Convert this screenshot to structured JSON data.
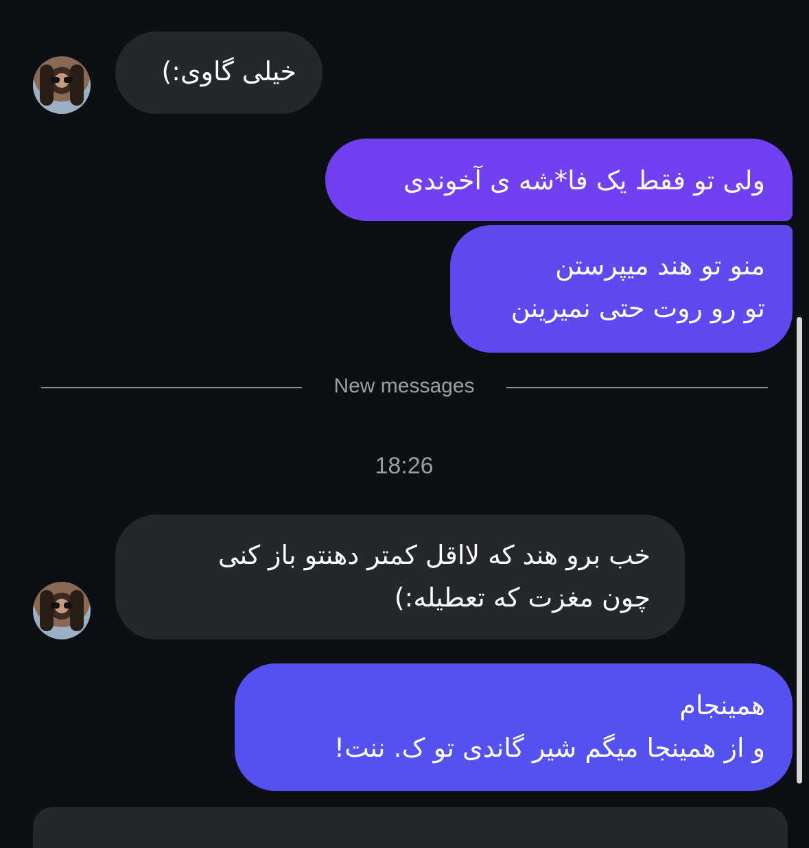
{
  "messages": [
    {
      "sender": "other",
      "text": "خیلی گاوی:)"
    },
    {
      "sender": "me",
      "text": "ولی تو فقط یک فا*شه ی آخوندی"
    },
    {
      "sender": "me",
      "lines": [
        "منو تو هند میپرستن",
        "تو رو روت حتی نمیرینن"
      ]
    },
    {
      "sender": "other",
      "lines": [
        "خب برو هند که لااقل کمتر دهنتو باز کنی",
        "چون مغزت که تعطیله:)"
      ]
    },
    {
      "sender": "me",
      "lines": [
        "همینجام",
        "و از همینجا میگم شیر گاندی تو ک. ننت!"
      ]
    }
  ],
  "divider": {
    "label": "New messages"
  },
  "timestamp": "18:26",
  "colors": {
    "background": "#0c0f14",
    "incoming_bubble": "#24272c",
    "outgoing_bubble": "#7140f0",
    "outgoing_bubble_alt": "#5551ef",
    "meta_text": "#9a9ea4"
  }
}
